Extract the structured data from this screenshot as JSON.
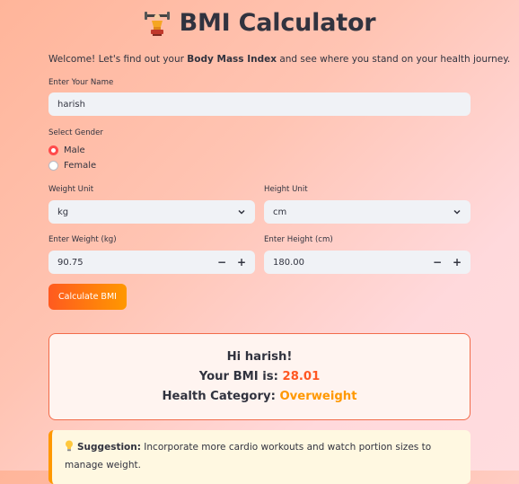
{
  "header": {
    "icon": "weightlifter-trophy-icon",
    "title": "BMI Calculator"
  },
  "welcome": {
    "prefix": "Welcome! Let's find out your ",
    "bold": "Body Mass Index",
    "suffix": " and see where you stand on your health journey."
  },
  "name": {
    "label": "Enter Your Name",
    "value": "harish"
  },
  "gender": {
    "label": "Select Gender",
    "options": [
      "Male",
      "Female"
    ],
    "selected": "Male"
  },
  "weight_unit": {
    "label": "Weight Unit",
    "value": "kg"
  },
  "height_unit": {
    "label": "Height Unit",
    "value": "cm"
  },
  "weight": {
    "label": "Enter Weight (kg)",
    "value": "90.75",
    "minus": "−",
    "plus": "+"
  },
  "height": {
    "label": "Enter Height (cm)",
    "value": "180.00",
    "minus": "−",
    "plus": "+"
  },
  "calculate_button": "Calculate BMI",
  "result": {
    "greeting": "Hi harish!",
    "bmi_label": "Your BMI is: ",
    "bmi_value": "28.01",
    "category_label": "Health Category: ",
    "category_value": "Overweight"
  },
  "suggestion": {
    "icon": "lightbulb-icon",
    "label": "Suggestion:",
    "text": " Incorporate more cardio workouts and watch portion sizes to manage weight."
  },
  "colors": {
    "accent": "#ff4b4b",
    "bmi_value": "#ff5722",
    "category_value": "#ff9800",
    "button_start": "#ff5a1f",
    "button_end": "#ff9800"
  }
}
